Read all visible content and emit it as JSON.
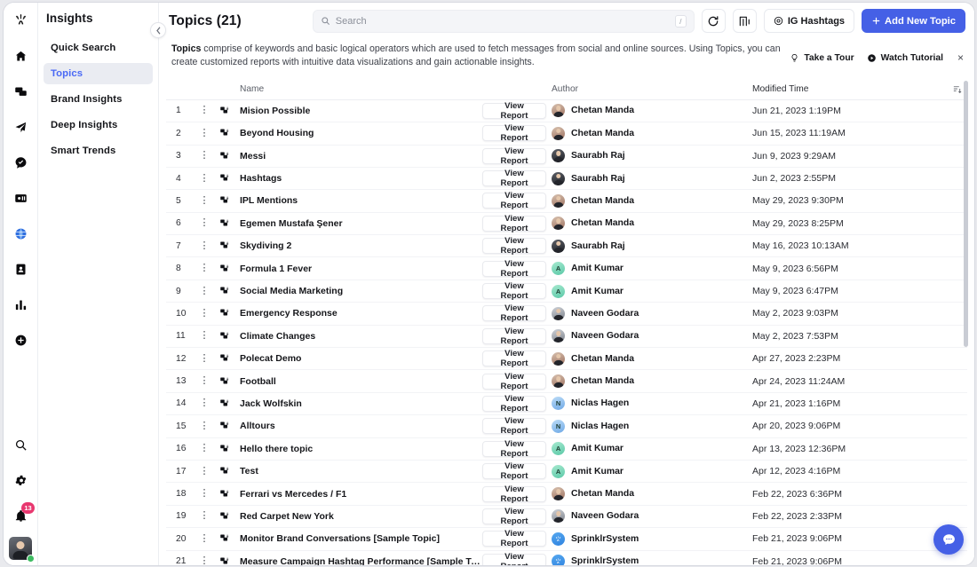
{
  "rail": {
    "logo_icon": "sprinklr-logo-icon",
    "items": [
      {
        "name": "home-icon"
      },
      {
        "name": "engagement-icon"
      },
      {
        "name": "publishing-icon"
      },
      {
        "name": "care-icon"
      },
      {
        "name": "ads-icon"
      },
      {
        "name": "insights-globe-icon",
        "active": true
      },
      {
        "name": "directory-icon"
      },
      {
        "name": "reporting-icon"
      },
      {
        "name": "add-circle-icon"
      }
    ],
    "bottom": [
      {
        "name": "search-icon"
      },
      {
        "name": "settings-gear-icon"
      },
      {
        "name": "notifications-bell-icon",
        "badge": "13"
      }
    ],
    "avatar_name": "user-avatar",
    "status": "online"
  },
  "sidebar": {
    "title": "Insights",
    "collapse_icon": "chevron-left-icon",
    "items": [
      {
        "label": "Quick Search",
        "active": false
      },
      {
        "label": "Topics",
        "active": true
      },
      {
        "label": "Brand Insights",
        "active": false
      },
      {
        "label": "Deep Insights",
        "active": false
      },
      {
        "label": "Smart Trends",
        "active": false
      }
    ]
  },
  "header": {
    "title": "Topics (21)",
    "search": {
      "value": "",
      "placeholder": "Search",
      "shortcut": "/"
    },
    "refresh_icon": "refresh-icon",
    "columns_icon": "columns-icon",
    "ig_hashtags_label": "IG Hashtags",
    "add_topic_label": "Add New Topic"
  },
  "banner": {
    "lead": "Topics",
    "text": " comprise of keywords and basic logical operators which are used to fetch messages from social and online sources. Using Topics, you can create customized reports with intuitive data visualizations and gain actionable insights.",
    "take_tour_label": "Take a Tour",
    "watch_tutorial_label": "Watch Tutorial",
    "close_label": "×"
  },
  "table": {
    "columns": {
      "name": "Name",
      "author": "Author",
      "modified": "Modified Time"
    },
    "sort_icon": "sort-icon",
    "view_report_label": "View Report",
    "row_menu_icon": "more-vertical-icon",
    "topic_icon": "topic-icon",
    "rows": [
      {
        "num": "1",
        "name": "Mision Possible",
        "author": "Chetan Manda",
        "avatar": "photo",
        "time": "Jun 21, 2023 1:19PM"
      },
      {
        "num": "2",
        "name": "Beyond Housing",
        "author": "Chetan Manda",
        "avatar": "photo",
        "time": "Jun 15, 2023 11:19AM"
      },
      {
        "num": "3",
        "name": "Messi",
        "author": "Saurabh Raj",
        "avatar": "photo2",
        "time": "Jun 9, 2023 9:29AM"
      },
      {
        "num": "4",
        "name": "Hashtags",
        "author": "Saurabh Raj",
        "avatar": "photo2",
        "time": "Jun 2, 2023 2:55PM"
      },
      {
        "num": "5",
        "name": "IPL Mentions",
        "author": "Chetan Manda",
        "avatar": "photo",
        "time": "May 29, 2023 9:30PM"
      },
      {
        "num": "6",
        "name": "Egemen Mustafa Şener",
        "author": "Chetan Manda",
        "avatar": "photo",
        "time": "May 29, 2023 8:25PM"
      },
      {
        "num": "7",
        "name": "Skydiving 2",
        "author": "Saurabh Raj",
        "avatar": "photo2",
        "time": "May 16, 2023 10:13AM"
      },
      {
        "num": "8",
        "name": "Formula 1 Fever",
        "author": "Amit Kumar",
        "avatar": "A",
        "time": "May 9, 2023 6:56PM"
      },
      {
        "num": "9",
        "name": "Social Media Marketing",
        "author": "Amit Kumar",
        "avatar": "A",
        "time": "May 9, 2023 6:47PM"
      },
      {
        "num": "10",
        "name": "Emergency Response",
        "author": "Naveen Godara",
        "avatar": "photo3",
        "time": "May 2, 2023 9:03PM"
      },
      {
        "num": "11",
        "name": "Climate Changes",
        "author": "Naveen Godara",
        "avatar": "photo3",
        "time": "May 2, 2023 7:53PM"
      },
      {
        "num": "12",
        "name": "Polecat Demo",
        "author": "Chetan Manda",
        "avatar": "photo",
        "time": "Apr 27, 2023 2:23PM"
      },
      {
        "num": "13",
        "name": "Football",
        "author": "Chetan Manda",
        "avatar": "photo",
        "time": "Apr 24, 2023 11:24AM"
      },
      {
        "num": "14",
        "name": "Jack Wolfskin",
        "author": "Niclas Hagen",
        "avatar": "N",
        "time": "Apr 21, 2023 1:16PM"
      },
      {
        "num": "15",
        "name": "Alltours",
        "author": "Niclas Hagen",
        "avatar": "N",
        "time": "Apr 20, 2023 9:06PM"
      },
      {
        "num": "16",
        "name": "Hello there topic",
        "author": "Amit Kumar",
        "avatar": "A",
        "time": "Apr 13, 2023 12:36PM"
      },
      {
        "num": "17",
        "name": "Test",
        "author": "Amit Kumar",
        "avatar": "A",
        "time": "Apr 12, 2023 4:16PM"
      },
      {
        "num": "18",
        "name": "Ferrari vs Mercedes / F1",
        "author": "Chetan Manda",
        "avatar": "photo",
        "time": "Feb 22, 2023 6:36PM"
      },
      {
        "num": "19",
        "name": "Red Carpet New York",
        "author": "Naveen Godara",
        "avatar": "photo3",
        "time": "Feb 22, 2023 2:33PM"
      },
      {
        "num": "20",
        "name": "Monitor Brand Conversations [Sample Topic]",
        "author": "SprinklrSystem",
        "avatar": "sys",
        "time": "Feb 21, 2023 9:06PM"
      },
      {
        "num": "21",
        "name": "Measure Campaign Hashtag Performance [Sample Topic]",
        "author": "SprinklrSystem",
        "avatar": "sys",
        "time": "Feb 21, 2023 9:06PM"
      }
    ]
  },
  "chat": {
    "icon": "chat-bubble-icon"
  },
  "colors": {
    "accent": "#4560e6",
    "active_nav": "#4a69f5",
    "badge": "#e8376f",
    "online": "#3dbb61"
  }
}
